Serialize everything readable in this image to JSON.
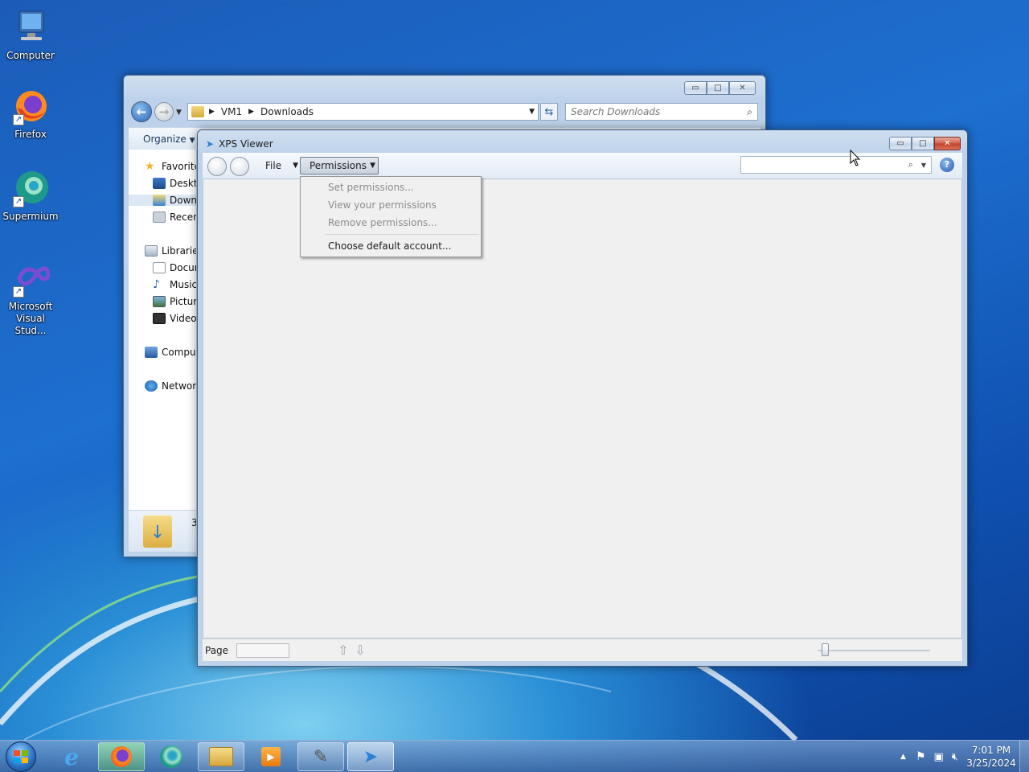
{
  "desktop": {
    "icons": [
      {
        "label": "Computer",
        "icon": "computer-icon"
      },
      {
        "label": "Firefox",
        "icon": "firefox-icon"
      },
      {
        "label": "Supermium",
        "icon": "supermium-icon"
      },
      {
        "label": "Microsoft Visual Stud...",
        "icon": "visual-studio-icon"
      }
    ]
  },
  "explorer": {
    "breadcrumb": [
      "VM1",
      "Downloads"
    ],
    "search_placeholder": "Search Downloads",
    "organize_label": "Organize",
    "nav": {
      "favorites": "Favorites",
      "desktop": "Desktop",
      "downloads": "Downloads",
      "recent": "Recent Places",
      "libraries": "Libraries",
      "documents": "Documents",
      "music": "Music",
      "pictures": "Pictures",
      "videos": "Videos",
      "computer": "Computer",
      "network": "Network"
    },
    "details_count": "3"
  },
  "xps": {
    "title": "XPS Viewer",
    "file_menu": "File",
    "permissions_menu": "Permissions",
    "permissions_items": [
      {
        "label": "Set permissions...",
        "enabled": false
      },
      {
        "label": "View your permissions",
        "enabled": false
      },
      {
        "label": "Remove permissions...",
        "enabled": false
      },
      {
        "label": "Choose default account...",
        "enabled": true
      }
    ],
    "page_label": "Page",
    "page_value": ""
  },
  "taskbar": {
    "apps": [
      "start-orb",
      "internet-explorer-icon",
      "firefox-icon",
      "supermium-icon",
      "file-explorer-icon",
      "media-player-icon",
      "cheat-engine-icon",
      "xps-viewer-icon"
    ],
    "time": "7:01 PM",
    "date": "3/25/2024"
  },
  "colors": {
    "accent": "#1d6fd0",
    "close_button": "#c2412c"
  }
}
